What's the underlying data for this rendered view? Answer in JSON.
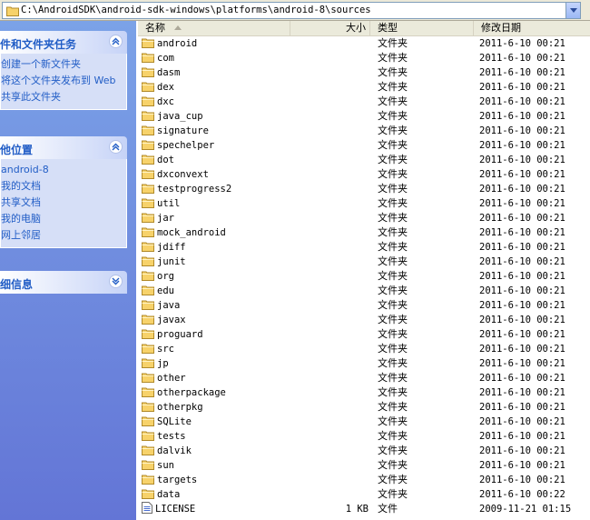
{
  "address": {
    "path": "C:\\AndroidSDK\\android-sdk-windows\\platforms\\android-8\\sources"
  },
  "tasks": {
    "title": "件和文件夹任务",
    "items": [
      "创建一个新文件夹",
      "将这个文件夹发布到 Web",
      "共享此文件夹"
    ]
  },
  "other_places": {
    "title": "他位置",
    "items": [
      "android-8",
      "我的文档",
      "共享文档",
      "我的电脑",
      "网上邻居"
    ]
  },
  "details": {
    "title": "细信息"
  },
  "columns": {
    "name": "名称",
    "size": "大小",
    "type": "类型",
    "date": "修改日期"
  },
  "files": [
    {
      "name": "android",
      "size": "",
      "type": "文件夹",
      "date": "2011-6-10 00:21",
      "kind": "folder"
    },
    {
      "name": "com",
      "size": "",
      "type": "文件夹",
      "date": "2011-6-10 00:21",
      "kind": "folder"
    },
    {
      "name": "dasm",
      "size": "",
      "type": "文件夹",
      "date": "2011-6-10 00:21",
      "kind": "folder"
    },
    {
      "name": "dex",
      "size": "",
      "type": "文件夹",
      "date": "2011-6-10 00:21",
      "kind": "folder"
    },
    {
      "name": "dxc",
      "size": "",
      "type": "文件夹",
      "date": "2011-6-10 00:21",
      "kind": "folder"
    },
    {
      "name": "java_cup",
      "size": "",
      "type": "文件夹",
      "date": "2011-6-10 00:21",
      "kind": "folder"
    },
    {
      "name": "signature",
      "size": "",
      "type": "文件夹",
      "date": "2011-6-10 00:21",
      "kind": "folder"
    },
    {
      "name": "spechelper",
      "size": "",
      "type": "文件夹",
      "date": "2011-6-10 00:21",
      "kind": "folder"
    },
    {
      "name": "dot",
      "size": "",
      "type": "文件夹",
      "date": "2011-6-10 00:21",
      "kind": "folder"
    },
    {
      "name": "dxconvext",
      "size": "",
      "type": "文件夹",
      "date": "2011-6-10 00:21",
      "kind": "folder"
    },
    {
      "name": "testprogress2",
      "size": "",
      "type": "文件夹",
      "date": "2011-6-10 00:21",
      "kind": "folder"
    },
    {
      "name": "util",
      "size": "",
      "type": "文件夹",
      "date": "2011-6-10 00:21",
      "kind": "folder"
    },
    {
      "name": "jar",
      "size": "",
      "type": "文件夹",
      "date": "2011-6-10 00:21",
      "kind": "folder"
    },
    {
      "name": "mock_android",
      "size": "",
      "type": "文件夹",
      "date": "2011-6-10 00:21",
      "kind": "folder"
    },
    {
      "name": "jdiff",
      "size": "",
      "type": "文件夹",
      "date": "2011-6-10 00:21",
      "kind": "folder"
    },
    {
      "name": "junit",
      "size": "",
      "type": "文件夹",
      "date": "2011-6-10 00:21",
      "kind": "folder"
    },
    {
      "name": "org",
      "size": "",
      "type": "文件夹",
      "date": "2011-6-10 00:21",
      "kind": "folder"
    },
    {
      "name": "edu",
      "size": "",
      "type": "文件夹",
      "date": "2011-6-10 00:21",
      "kind": "folder"
    },
    {
      "name": "java",
      "size": "",
      "type": "文件夹",
      "date": "2011-6-10 00:21",
      "kind": "folder"
    },
    {
      "name": "javax",
      "size": "",
      "type": "文件夹",
      "date": "2011-6-10 00:21",
      "kind": "folder"
    },
    {
      "name": "proguard",
      "size": "",
      "type": "文件夹",
      "date": "2011-6-10 00:21",
      "kind": "folder"
    },
    {
      "name": "src",
      "size": "",
      "type": "文件夹",
      "date": "2011-6-10 00:21",
      "kind": "folder"
    },
    {
      "name": "jp",
      "size": "",
      "type": "文件夹",
      "date": "2011-6-10 00:21",
      "kind": "folder"
    },
    {
      "name": "other",
      "size": "",
      "type": "文件夹",
      "date": "2011-6-10 00:21",
      "kind": "folder"
    },
    {
      "name": "otherpackage",
      "size": "",
      "type": "文件夹",
      "date": "2011-6-10 00:21",
      "kind": "folder"
    },
    {
      "name": "otherpkg",
      "size": "",
      "type": "文件夹",
      "date": "2011-6-10 00:21",
      "kind": "folder"
    },
    {
      "name": "SQLite",
      "size": "",
      "type": "文件夹",
      "date": "2011-6-10 00:21",
      "kind": "folder"
    },
    {
      "name": "tests",
      "size": "",
      "type": "文件夹",
      "date": "2011-6-10 00:21",
      "kind": "folder"
    },
    {
      "name": "dalvik",
      "size": "",
      "type": "文件夹",
      "date": "2011-6-10 00:21",
      "kind": "folder"
    },
    {
      "name": "sun",
      "size": "",
      "type": "文件夹",
      "date": "2011-6-10 00:21",
      "kind": "folder"
    },
    {
      "name": "targets",
      "size": "",
      "type": "文件夹",
      "date": "2011-6-10 00:21",
      "kind": "folder"
    },
    {
      "name": "data",
      "size": "",
      "type": "文件夹",
      "date": "2011-6-10 00:22",
      "kind": "folder"
    },
    {
      "name": "LICENSE",
      "size": "1 KB",
      "type": "文件",
      "date": "2009-11-21 01:15",
      "kind": "file"
    }
  ],
  "colors": {
    "pane_top": "#7ba2e7",
    "pane_bottom": "#6375d6",
    "link": "#215dc6",
    "folder": "#f7d26a"
  }
}
